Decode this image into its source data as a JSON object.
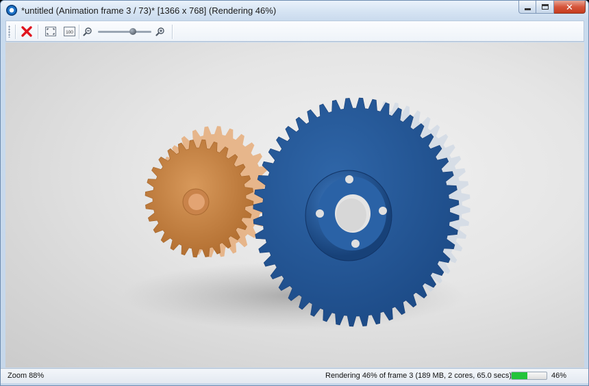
{
  "window": {
    "title": "*untitled (Animation frame 3 / 73)* [1366 x 768] (Rendering 46%)",
    "caption_close": "✕"
  },
  "toolbar": {
    "one_to_one_label": "100",
    "icons": [
      "stop-render-icon",
      "fit-window-icon",
      "actual-size-icon",
      "zoom-out-icon",
      "zoom-in-icon"
    ],
    "zoom_slider": 0.7
  },
  "scene": {
    "small_gear_color": "#c98645",
    "large_gear_color": "#24589a",
    "background_color": "#e4e4e4"
  },
  "status": {
    "zoom": "Zoom 88%",
    "rendering": "Rendering 46% of frame 3 (189 MB, 2 cores, 65.0 secs)",
    "percent": "46%",
    "progress": 0.46,
    "progress_color": "#22c43a"
  }
}
